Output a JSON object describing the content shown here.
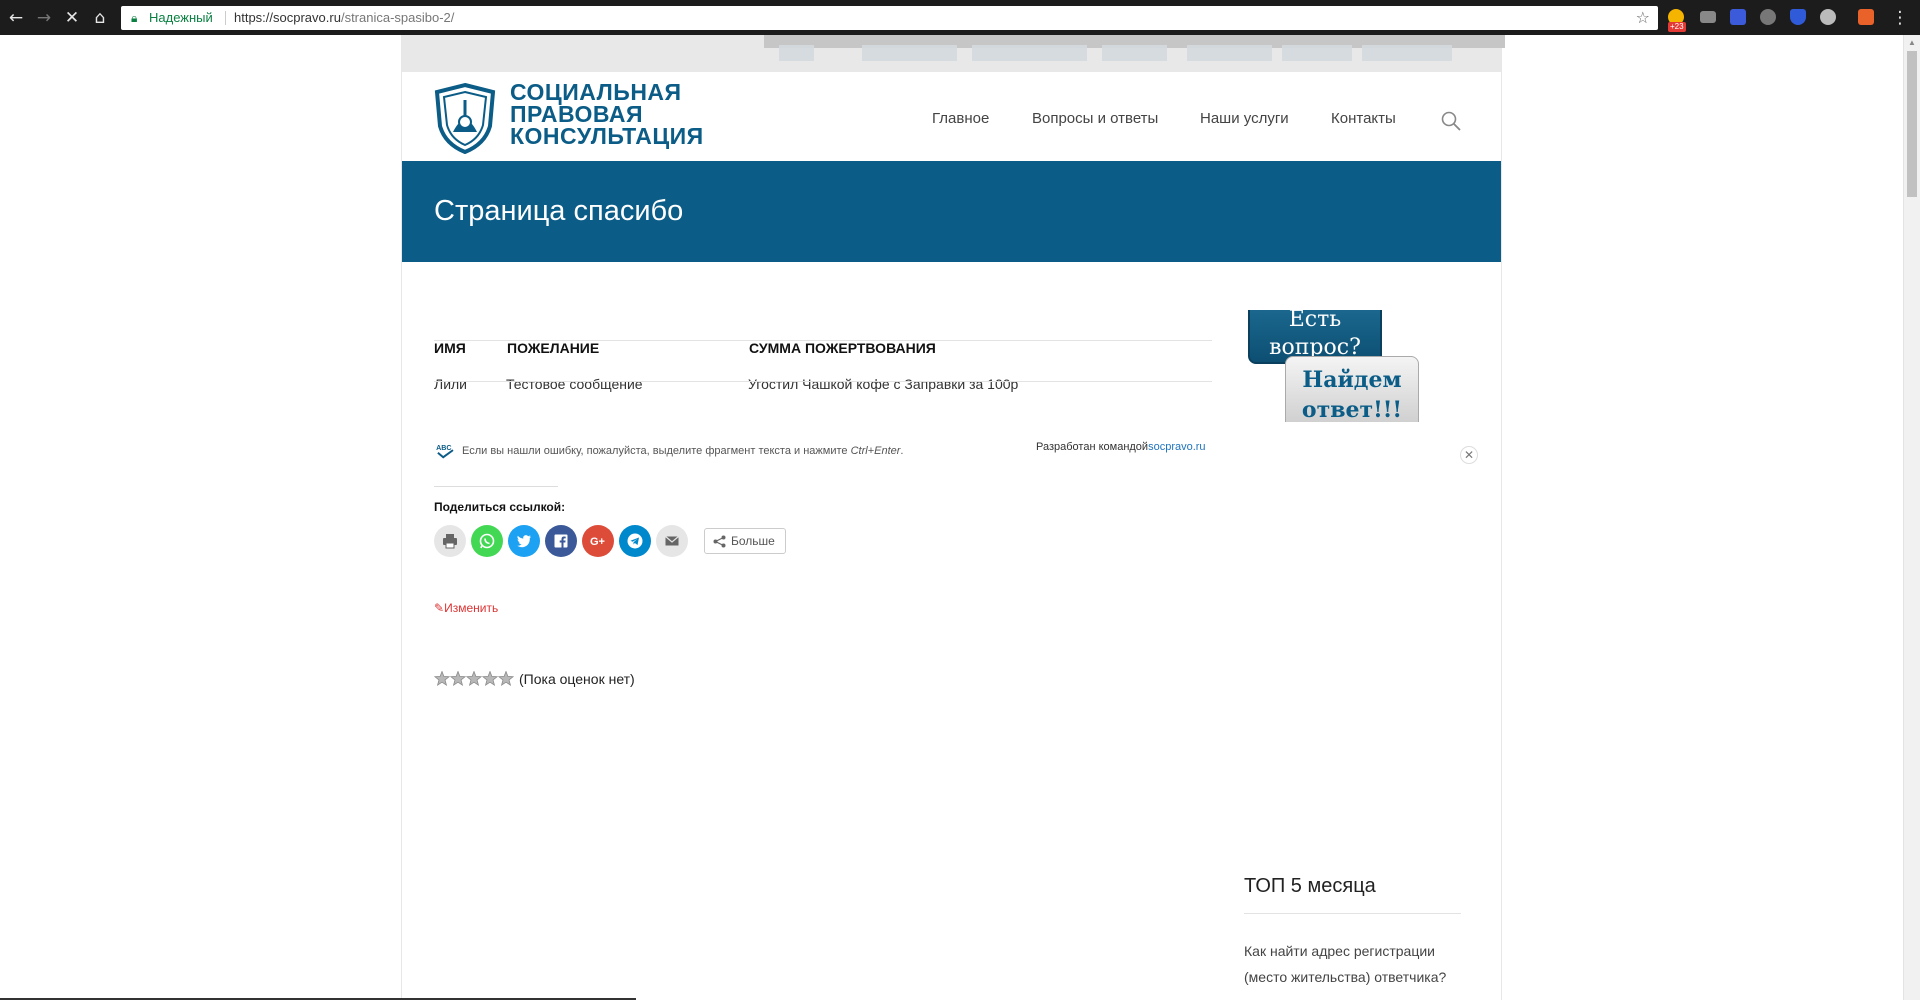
{
  "browser": {
    "secure_label": "Надежный",
    "url_host": "https://socpravo.ru",
    "url_path": "/stranica-spasibo-2/",
    "extension_badge": "+23"
  },
  "site": {
    "logo_lines": [
      "СОЦИАЛЬНАЯ",
      "ПРАВОВАЯ",
      "КОНСУЛЬТАЦИЯ"
    ],
    "menu": [
      "Главное",
      "Вопросы и ответы",
      "Наши услуги",
      "Контакты"
    ],
    "page_title": "Страница спасибо"
  },
  "donations": {
    "headers": [
      "Имя",
      "Пожелание",
      "Сумма пожертвования"
    ],
    "rows": [
      [
        "Лили",
        "Тестовое сообщение",
        "Угостил Чашкой кофе с Заправки за 100р"
      ]
    ]
  },
  "notes": {
    "error_note_prefix": "Если вы нашли ошибку, пожалуйста, выделите фрагмент текста и нажмите ",
    "error_note_keys": "Ctrl+Enter",
    "error_note_suffix": ".",
    "dev_prefix": "Разработан командой",
    "dev_link": "socpravo.ru"
  },
  "share": {
    "title": "Поделиться ссылкой:",
    "buttons": [
      "print-icon",
      "whatsapp-icon",
      "twitter-icon",
      "facebook-icon",
      "google-plus-icon",
      "telegram-icon",
      "email-icon"
    ],
    "more_label": "Больше"
  },
  "edit_label": "Изменить",
  "rating": {
    "stars_filled": 0,
    "stars_total": 5,
    "text": "(Пока оценок нет)"
  },
  "ad": {
    "line1": "Есть вопрос?",
    "line2": "Найдем ответ!!!"
  },
  "sidebar": {
    "widget_title": "ТОП 5 месяца",
    "items": [
      "Как найти адрес регистрации (место жительства) ответчика?"
    ]
  },
  "colors": {
    "brand": "#0b5c86",
    "link": "#1e73be",
    "edit": "#dd3333"
  }
}
